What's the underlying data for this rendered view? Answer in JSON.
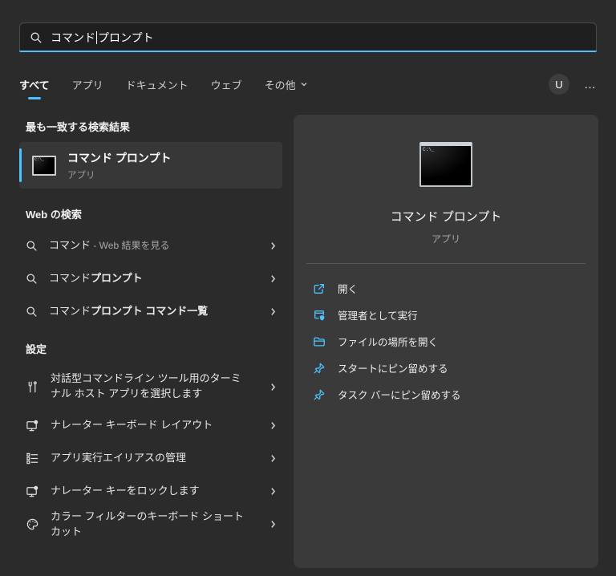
{
  "colors": {
    "accent": "#4cc2ff",
    "background": "#2b2b2b",
    "panel": "#3a3a3a",
    "card": "#373737"
  },
  "search": {
    "query_before_cursor": "コマンド",
    "query_after_cursor": "プロンプト",
    "icon": "search-icon"
  },
  "tabs": {
    "all": "すべて",
    "apps": "アプリ",
    "documents": "ドキュメント",
    "web": "ウェブ",
    "more": "その他",
    "active": "すべて"
  },
  "header_right": {
    "avatar_initial": "U",
    "more_options": "…"
  },
  "sections": {
    "best_match": {
      "title": "最も一致する検索結果",
      "item": {
        "icon": "cmd-app-icon",
        "name": "コマンド プロンプト",
        "type": "アプリ"
      }
    },
    "web_search": {
      "title": "Web の検索",
      "items": [
        {
          "icon": "search-icon",
          "query": "コマンド",
          "bold": "",
          "suffix": " - Web 結果を見る"
        },
        {
          "icon": "search-icon",
          "query": "コマンド",
          "bold": "プロンプト",
          "suffix": ""
        },
        {
          "icon": "search-icon",
          "query": "コマンド",
          "bold": "プロンプト コマンド一覧",
          "suffix": ""
        }
      ]
    },
    "settings": {
      "title": "設定",
      "items": [
        {
          "icon": "tools-icon",
          "label": "対話型コマンドライン ツール用のターミナル ホスト アプリを選択します"
        },
        {
          "icon": "narrator-display-icon",
          "label": "ナレーター キーボード レイアウト"
        },
        {
          "icon": "list-icon",
          "label": "アプリ実行エイリアスの管理"
        },
        {
          "icon": "narrator-display-icon",
          "label": "ナレーター キーをロックします"
        },
        {
          "icon": "palette-icon",
          "label": "カラー フィルターのキーボード ショートカット"
        }
      ]
    }
  },
  "preview": {
    "icon": "cmd-app-icon-large",
    "title": "コマンド プロンプト",
    "subtitle": "アプリ",
    "actions": [
      {
        "icon": "open-external-icon",
        "label": "開く"
      },
      {
        "icon": "run-as-admin-icon",
        "label": "管理者として実行"
      },
      {
        "icon": "folder-icon",
        "label": "ファイルの場所を開く"
      },
      {
        "icon": "pin-icon",
        "label": "スタートにピン留めする"
      },
      {
        "icon": "pin-icon",
        "label": "タスク バーにピン留めする"
      }
    ]
  }
}
